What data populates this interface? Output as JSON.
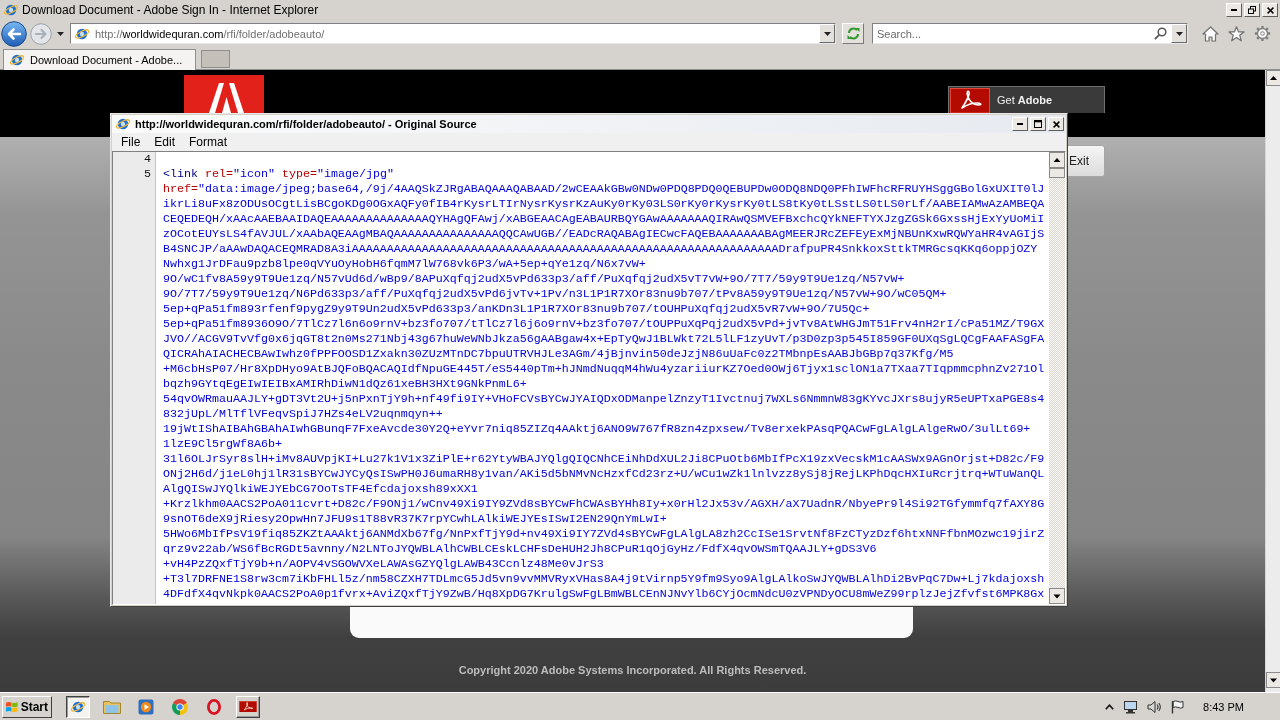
{
  "browser": {
    "title": "Download Document - Adobe Sign In - Internet Explorer",
    "address": {
      "scheme": "http://",
      "domain": "worldwidequran.com",
      "path": "/rfi/folder/adobeauto/"
    },
    "search": {
      "placeholder": "Search..."
    },
    "tabs": [
      {
        "label": "Download Document - Adobe...",
        "selected": true
      }
    ]
  },
  "page": {
    "badge": "Get **Adobe**",
    "exit_button": "Exit",
    "copyright": "Copyright 2020 Adobe Systems Incorporated. All Rights Reserved."
  },
  "source_window": {
    "title": "http://worldwidequran.com/rfi/folder/adobeauto/ - Original Source",
    "menu": [
      "File",
      "Edit",
      "Format"
    ],
    "lines": [
      {
        "number": "4"
      },
      {
        "number": "5",
        "rows": [
          [
            {
              "kind": "tag",
              "text": "<link"
            },
            {
              "kind": "attr",
              "text": " rel="
            },
            {
              "kind": "value",
              "text": "\"icon\""
            },
            {
              "kind": "attr",
              "text": " type="
            },
            {
              "kind": "value",
              "text": "\"image/jpg\""
            }
          ],
          [
            {
              "kind": "attr",
              "text": "href="
            },
            {
              "kind": "value",
              "text": "\"data:image/jpeg;base64,/9j/4AAQSkZJRgABAQAAAQABAAD/2wCEAAkGBw0NDw0PDQ8PDQ0QEBUPDw0ODQ8NDQ0PFhIWFhcRFRUYHSggGBolGxUXIT0lJ"
            }
          ],
          [
            {
              "kind": "value",
              "text": "ikrLi8uFx8zODUsOCgtLisBCgoKDg0OGxAQFy0fIB4rKysrLTIrNysrKysrKzAuKy0rKy03LS0rKy0rKysrKy0tLS8tKy0tLSstLS0tLS0rLf/AABEIAMwAzAMBEQA"
            }
          ],
          [
            {
              "kind": "value",
              "text": "CEQEDEQH/xAAcAAEBAAIDAQEAAAAAAAAAAAAAAQYHAgQFAwj/xABGEAACAgEABAURBQYGAwAAAAAAAQIRAwQSMVEFBxchcQYkNEFTYXJzgZGSk6GxssHjExYyUoMiI"
            }
          ],
          [
            {
              "kind": "value",
              "text": "zOCotEUYsLS4fAVJUL/xAAbAQEAAgMBAQAAAAAAAAAAAAAAAQQCAwUGB//EADcRAQABAgIECwcFAQEBAAAAAAABAgMEERJRcZEFEyExMjNBUnKxwRQWYaHR4vAGIjS"
            }
          ],
          [
            {
              "kind": "value",
              "text": "B4SNCJP/aAAwDAQACEQMRAD8A3iAAAAAAAAAAAAAAAAAAAAAAAAAAAAAAAAAAAAAAAAAAAAAAAAAAAAAAAAAAAAADrafpuPR4SnkkoxSttkTMRGcsqKKq6oppjOZY"
            }
          ],
          [
            {
              "kind": "value",
              "text": "Nwhxg1JrDFau9pzb8lpe0qVYuOyHobH6fqmM7lW768vk6P3/wA+5ep+qYe1zq/N6x7vW+"
            }
          ],
          [
            {
              "kind": "value",
              "text": "9O/wC1fv8A59y9T9Ue1zq/N57vUd6d/wBp9/8APuXqfqj2udX5vPd633p3/aff/PuXqfqj2udX5vT7vW+9O/7T7/59y9T9Ue1zq/N57vW+"
            }
          ],
          [
            {
              "kind": "value",
              "text": "9O/7T7/59y9T9Ue1zq/N6Pd633p3/aff/PuXqfqj2udX5vPd6jvTv+1Pv/n3L1P1R7XOr83nu9b707/tPv8A59y9T9Ue1zq/N57vW+9O/wC05QM+"
            }
          ],
          [
            {
              "kind": "value",
              "text": "5ep+qPa51fm893rfenf9pygZ9y9T9Un2udX5vPd633p3/anKDn3L1P1R7XOr83nu9b707/tOUHPuXqfqj2udX5vR7vW+9O/7U5Qc+"
            }
          ],
          [
            {
              "kind": "value",
              "text": "5ep+qPa51fm8936O9O/7TlCz7l6n6o9rnV+bz3fo707/tTlCz7l6j6o9rnV+bz3fo707/tOUPPuXqPqj2udX5vPd+jvTv8AtWHGJmT51Frv4nH2rI/cPa51MZ/T9GX"
            }
          ],
          [
            {
              "kind": "value",
              "text": "JVO//ACGV9TvVfg0x6jqGT8t2n0Ms271Nbj43g67huWeWNbJkza56gAABgaw4x+EpTyQwJ1BLWkt72L5lLF1zyUvT/p3D0zp3p545I859GF0UXqSgLQCgFAAFASgFA"
            }
          ],
          [
            {
              "kind": "value",
              "text": "QICRAhAIACHECBAwIwhz0fPPFOOSD1Zxakn30ZUzMTnDC7bpuUTRVHJLe3AGm/4jBjnvin50deJzjN86uUaFc0z2TMbnpEsAABJbGBp7q37Kfg/M5"
            }
          ],
          [
            {
              "kind": "value",
              "text": "+M6cbHsP07/Hr8XpDHyo9AtBJQFoBQACAQIdfNpuGE445T/eS5440pTm+hJNmdNuqqM4hWu4yzariiurKZ7Oed0OWj6Tjyx1sclON1a7TXaa7TIqpmmcphnZv271Ol"
            }
          ],
          [
            {
              "kind": "value",
              "text": "bqzh9GYtqEgEIwIEIBxAMIRhDiwN1dQz61xeBH3HXt9GNkPnmL6+"
            }
          ],
          [
            {
              "kind": "value",
              "text": "54qvOWRmauAAJLY+gDT3Vt2U+j5nPxnTjY9h+nf49fi9IY+VHoFCVsBYCwJYAIQDxODManpelZnzyT1Ivctnuj7WXLs6NmmnW83gKYvcJXrs8ujyR5eUPTxaPGE8s4"
            }
          ],
          [
            {
              "kind": "value",
              "text": "832jUpL/MlTflVFeqvSpiJ7HZs4eLV2uqnmqyn++"
            }
          ],
          [
            {
              "kind": "value",
              "text": "19jWtIShAIBAhGBAhAIwhGBunqF7FxeAvcde30Y2Q+eYvr7niq85ZIZq4AAktj6ANO9W767fR8zn4zpxsew/Tv8erxekPAsqPQACwFgLAlgLAlgeRwO/3ulLt69+"
            }
          ],
          [
            {
              "kind": "value",
              "text": "1lzE9Cl5rgWf8A6b+"
            }
          ],
          [
            {
              "kind": "value",
              "text": "31l6OLJrSyr8slH+iMv8AUVpjKI+Lu27k1V1x3ZiPlE+r62YtyWBAJYQlgQIQCNhCEiNhDdXUL2Ji8CPuOtb6MbIfPcX19zxVecskM1cAASWx9AGnOrjst+D82c/F9"
            }
          ],
          [
            {
              "kind": "value",
              "text": "ONj2H6d/j1eL0hj1lR31sBYCwJYCyQsISwPH0J6umaRH8y1van/AKi5d5bNMvNcHzxfCd23rz+U/wCu1wZk1lnlvzz8ySj8jRejLKPhDqcHXIuRcrjtrq+WTuWanQL"
            }
          ],
          [
            {
              "kind": "value",
              "text": "AlgQISwJYQlkiWEJYEbCG7OoTsTF4Efcdajoxsh89xXX1"
            }
          ],
          [
            {
              "kind": "value",
              "text": "+Krzlkhm0AACS2PoA011cvrt+D82c/F9ONj1/wCnv49Xi9IY9ZVd8sBYCwFhCWAsBYHh8Iy+x0rHl2Jx53v/AGXH/aX7UadnR/NbyePr9l4Si92TGfymmfq7fAXY8G"
            }
          ],
          [
            {
              "kind": "value",
              "text": "9snOT6deX9jRiesy2OpwHn7JFU9s1T88vR37K7rpYCwhLAlkiWEJYEsISwI2EN29QnYmLwI+"
            }
          ],
          [
            {
              "kind": "value",
              "text": "5HWo6MbIfPsV19fiq85ZKZtAAAktj6ANMdXb67fg/NnPxfTjY9d+nv49Xi9IY7ZVd4sBYCwFgLAlgLA8zh2CcISe1SrvtNf8FzCTyzDzf6htxNNFfbnMOzwc19jirZ"
            }
          ],
          [
            {
              "kind": "value",
              "text": "qrz9v22ab/WS6fBcRGDt5avnny/N2LNToJYQWBLAlhCWBLCEskLCHFsDeHUH2Jh8CPuR1qOjGyHz/FdfX4qvOWSmTQAAJLY+gDS3V6"
            }
          ],
          [
            {
              "kind": "value",
              "text": "+vH4PzZQxfTjY9b+n/AOPV4vSGOWVXeLAWAsGZYQlgLAWB43Ccnlz48Me0vJrS3"
            }
          ],
          [
            {
              "kind": "value",
              "text": "+T3l7DRFNE1S8rw3cm7iKbFHLl5z/nm58CZXH7TDLmcG5Jd5vn9vvMMVRyxVHas8A4j9tVirnp5Y9fm9Syo9AlgLAlkoSwJYQWBLAlhDi2BvPqC7Dw+Lj7kdajoxsh"
            }
          ],
          [
            {
              "kind": "value",
              "text": "4DFdfX4qvNkpk0AACS2PoA0p1fvrx+AviZQxfTjY9ZwB/Hq8XpDG7KrulgSwFgLBmWBLCEnNJNvYlb6CYjOcmNdcU0zVPNDyOCU8mWeZ99rplzJejZfvfst6MPK8Gx"
            }
          ]
        ]
      }
    ]
  },
  "taskbar": {
    "start": "Start",
    "apps": [
      {
        "selected": true,
        "open": true
      },
      {
        "selected": false,
        "open": false
      },
      {
        "selected": false,
        "open": false
      },
      {
        "selected": false,
        "open": false
      },
      {
        "selected": false,
        "open": false
      },
      {
        "selected": false,
        "open": true
      }
    ],
    "clock": "8:43 PM"
  }
}
